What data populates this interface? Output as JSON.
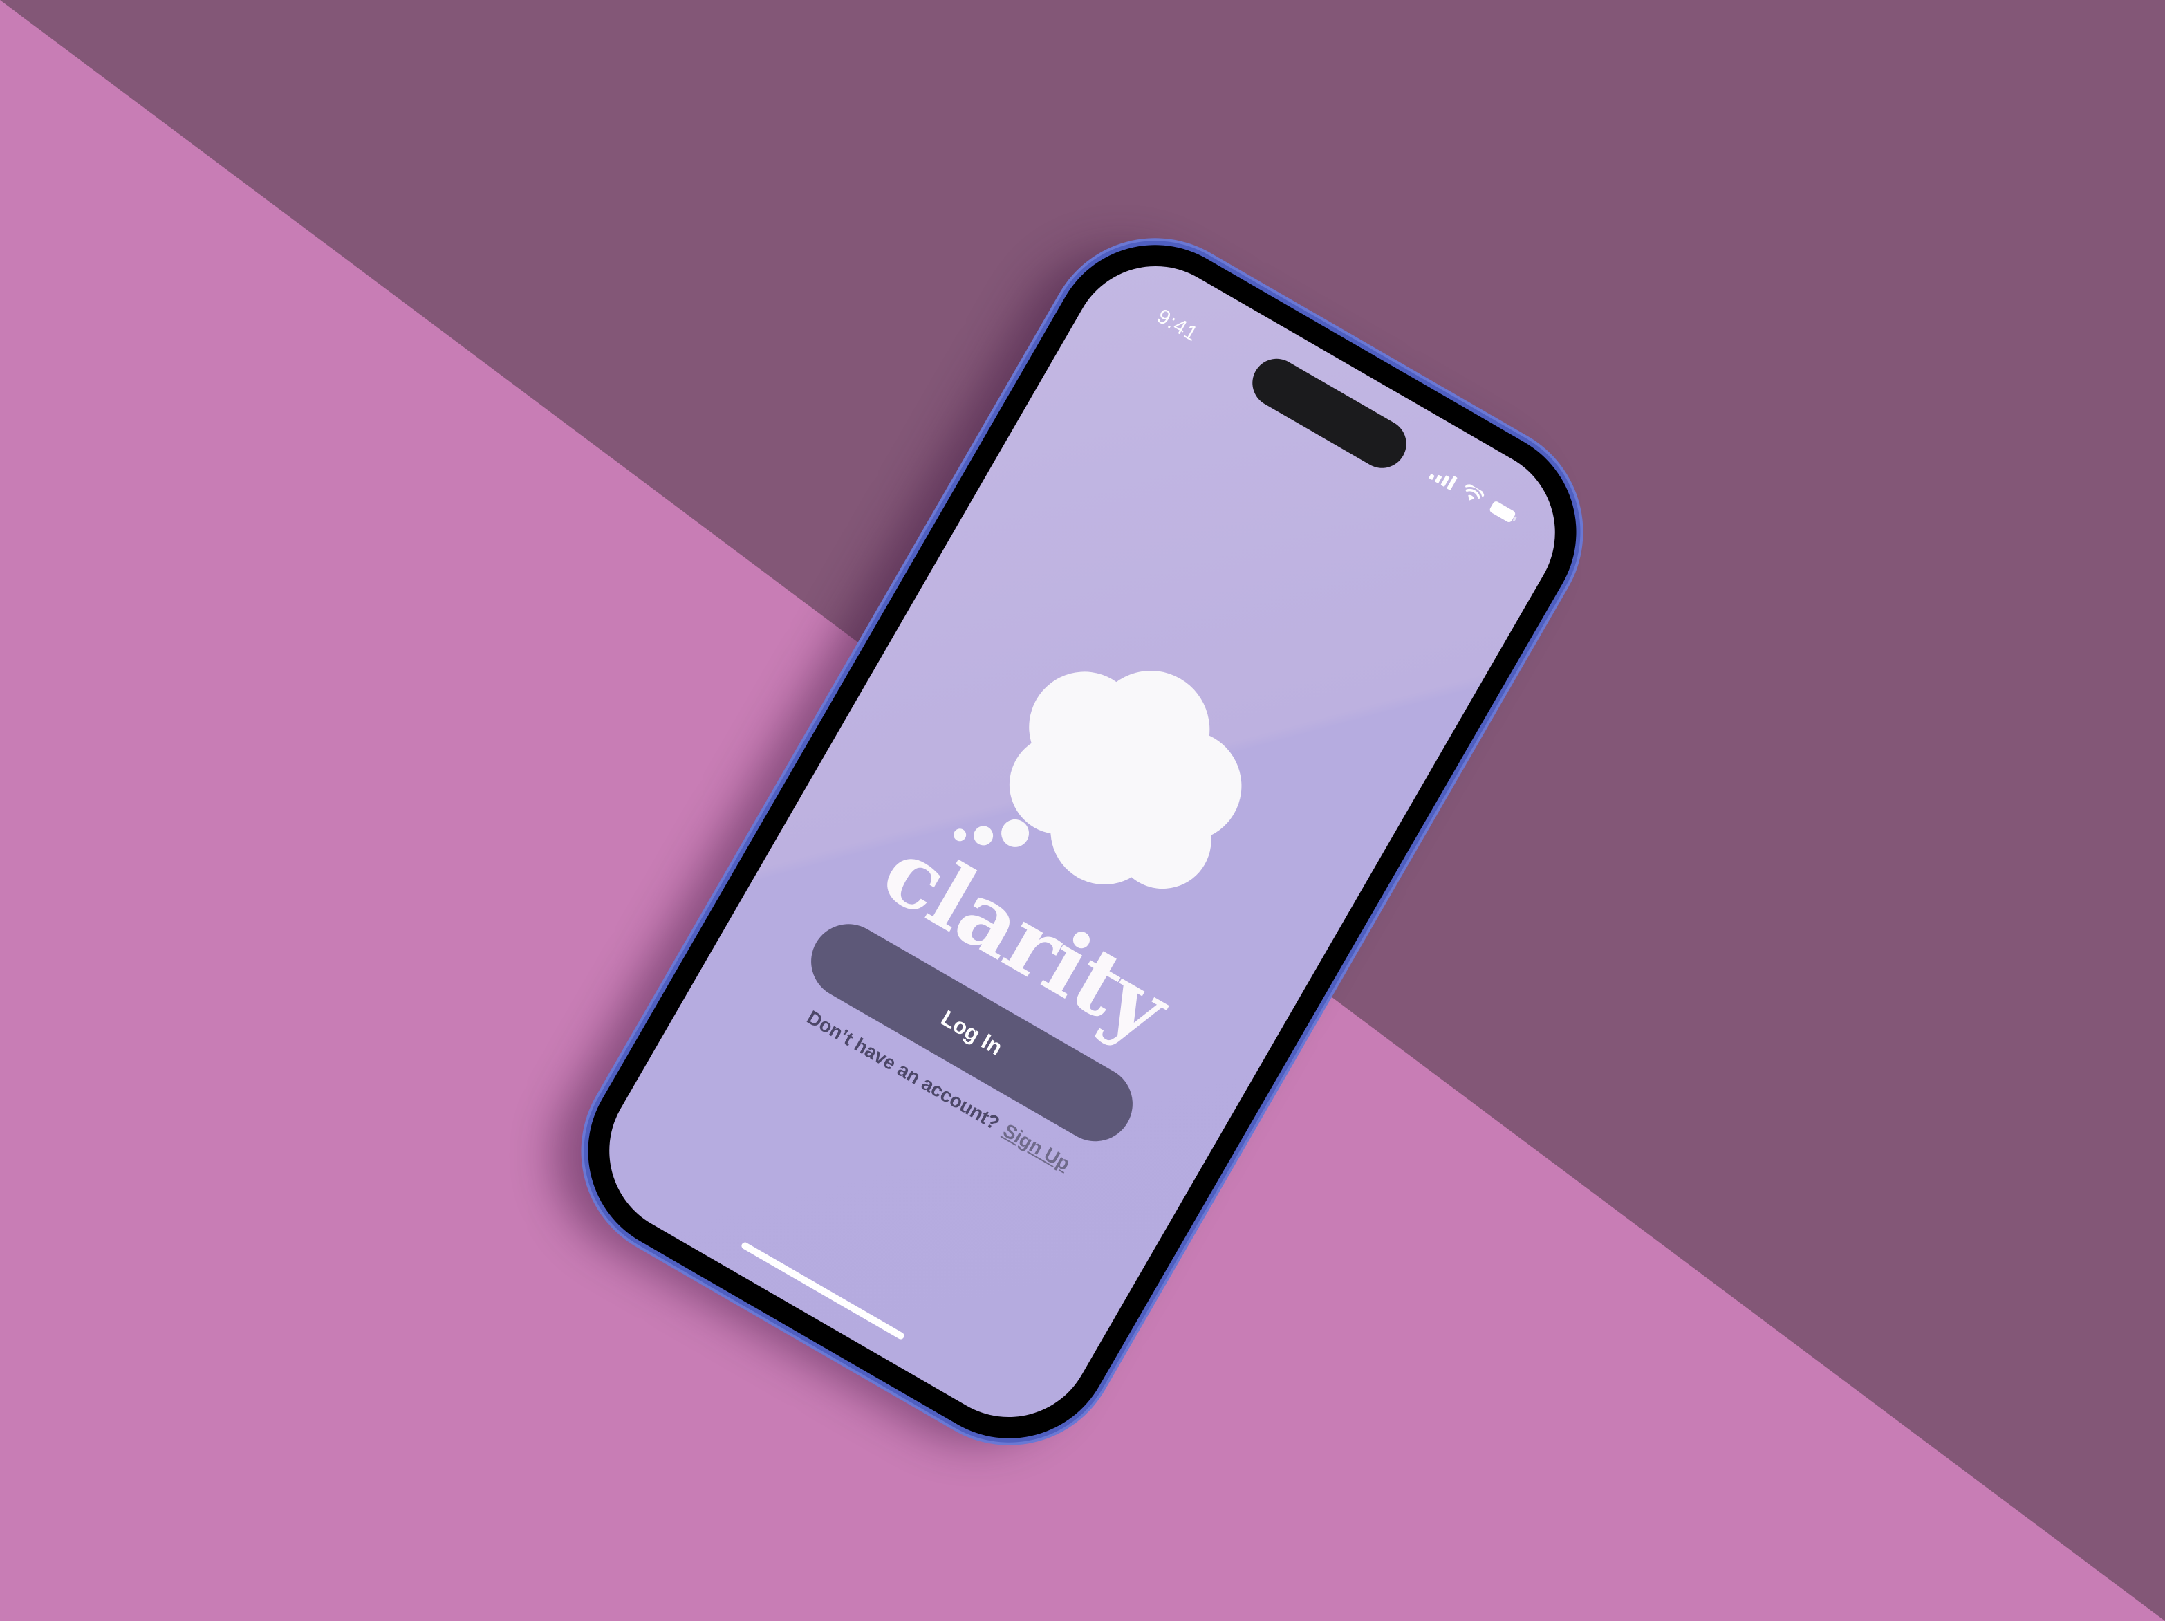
{
  "background": {
    "colors": {
      "pink": "#c87db5",
      "plum": "#835777"
    }
  },
  "status_bar": {
    "time": "9:41",
    "icons": [
      "cellular-signal-icon",
      "wifi-icon",
      "battery-icon"
    ]
  },
  "app": {
    "logo_icon": "thought-cloud-icon",
    "name": "clarity",
    "login_label": "Log In",
    "signup_prompt": "Don’t have an account?",
    "signup_link": "Sign Up"
  },
  "colors": {
    "screen": "#b8aee0",
    "button": "#5d5878",
    "frame": "#4f5fc0"
  }
}
